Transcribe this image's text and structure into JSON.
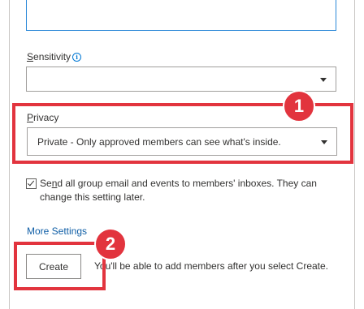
{
  "sensitivity": {
    "label_underlined": "S",
    "label_rest": "ensitivity",
    "info_icon": "info-icon",
    "info_glyph": "i",
    "value": ""
  },
  "privacy": {
    "label_underlined": "P",
    "label_rest": "rivacy",
    "value": "Private - Only approved members can see what's inside."
  },
  "send_email": {
    "checked": true,
    "text_pre": "Se",
    "text_underlined": "n",
    "text_post": "d all group email and events to members' inboxes. They can change this setting later."
  },
  "more_settings_label": "More Settings",
  "create_button_label": "Create",
  "create_hint": "You'll be able to add members after you select Create.",
  "callouts": [
    {
      "number": "1"
    },
    {
      "number": "2"
    }
  ],
  "colors": {
    "callout_red": "#e2343e",
    "link_blue": "#0f5ea6",
    "focus_blue": "#2b88d8"
  }
}
